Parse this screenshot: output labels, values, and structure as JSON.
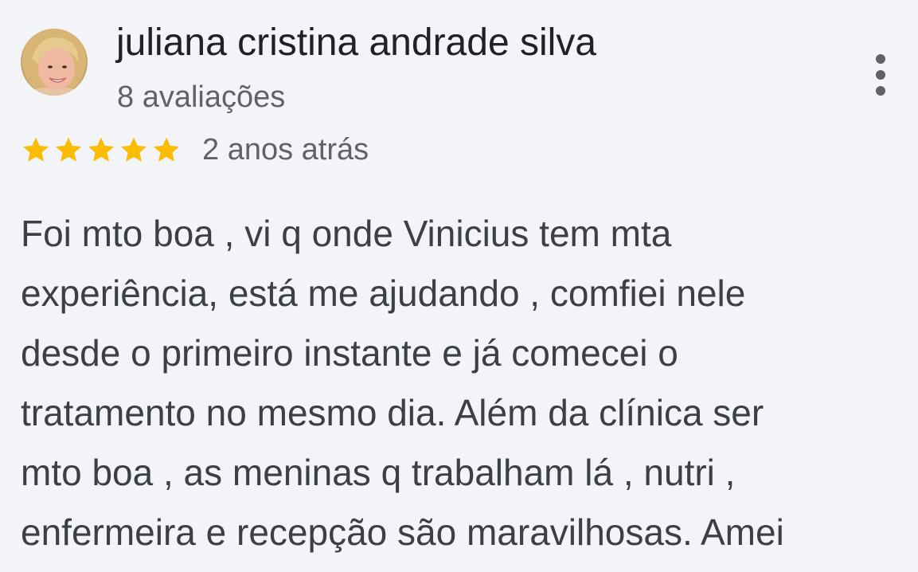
{
  "reviewer": {
    "name": "juliana cristina andrade silva",
    "reviews_count": "8 avaliações",
    "avatar_icon": "profile-photo"
  },
  "rating": {
    "stars": 5,
    "max_stars": 5,
    "star_color": "#fbbc04",
    "time_ago": "2 anos atrás"
  },
  "menu": {
    "icon": "more-vertical-icon"
  },
  "review": {
    "lines": [
      "Foi mto boa , vi q onde Vinicius tem mta",
      "experiência, está me ajudando , comfiei nele",
      "desde o primeiro instante e já comecei o",
      "tratamento no mesmo dia. Além da clínica ser",
      "mto boa , as meninas q trabalham lá , nutri ,",
      "enfermeira e recepção são maravilhosas. Amei"
    ]
  },
  "colors": {
    "background": "#f3f4f7",
    "name_text": "#202124",
    "secondary_text": "#5f6368",
    "body_text": "#3c4043"
  }
}
